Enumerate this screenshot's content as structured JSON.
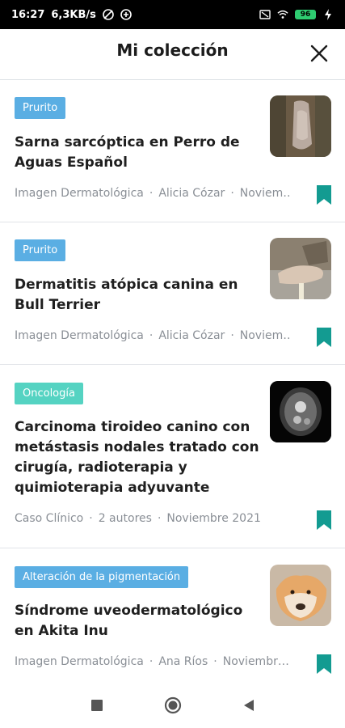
{
  "status": {
    "time": "16:27",
    "speed": "6,3KB/s",
    "battery": "96"
  },
  "header": {
    "title": "Mi colección"
  },
  "cards": [
    {
      "tag": "Prurito",
      "title": "Sarna sarcóptica en Perro de Aguas Español",
      "meta": [
        "Imagen Dermatológica",
        "Alicia Cózar",
        "Noviem…"
      ]
    },
    {
      "tag": "Prurito",
      "title": "Dermatitis atópica canina en Bull Terrier",
      "meta": [
        "Imagen Dermatológica",
        "Alicia Cózar",
        "Noviem…"
      ]
    },
    {
      "tag": "Oncología",
      "title": "Carcinoma tiroideo canino con metástasis nodales tratado con cirugía, radioterapia y quimioterapia adyuvante",
      "meta": [
        "Caso Clínico",
        "2 autores",
        "Noviembre 2021"
      ]
    },
    {
      "tag": "Alteración de la pigmentación",
      "title": "Síndrome uveodermatológico en Akita Inu",
      "meta": [
        "Imagen Dermatológica",
        "Ana Ríos",
        "Noviembr…"
      ]
    }
  ],
  "colors": {
    "accent": "#139b91",
    "tag_blue": "#5aaee3",
    "tag_teal": "#55d3c2"
  }
}
